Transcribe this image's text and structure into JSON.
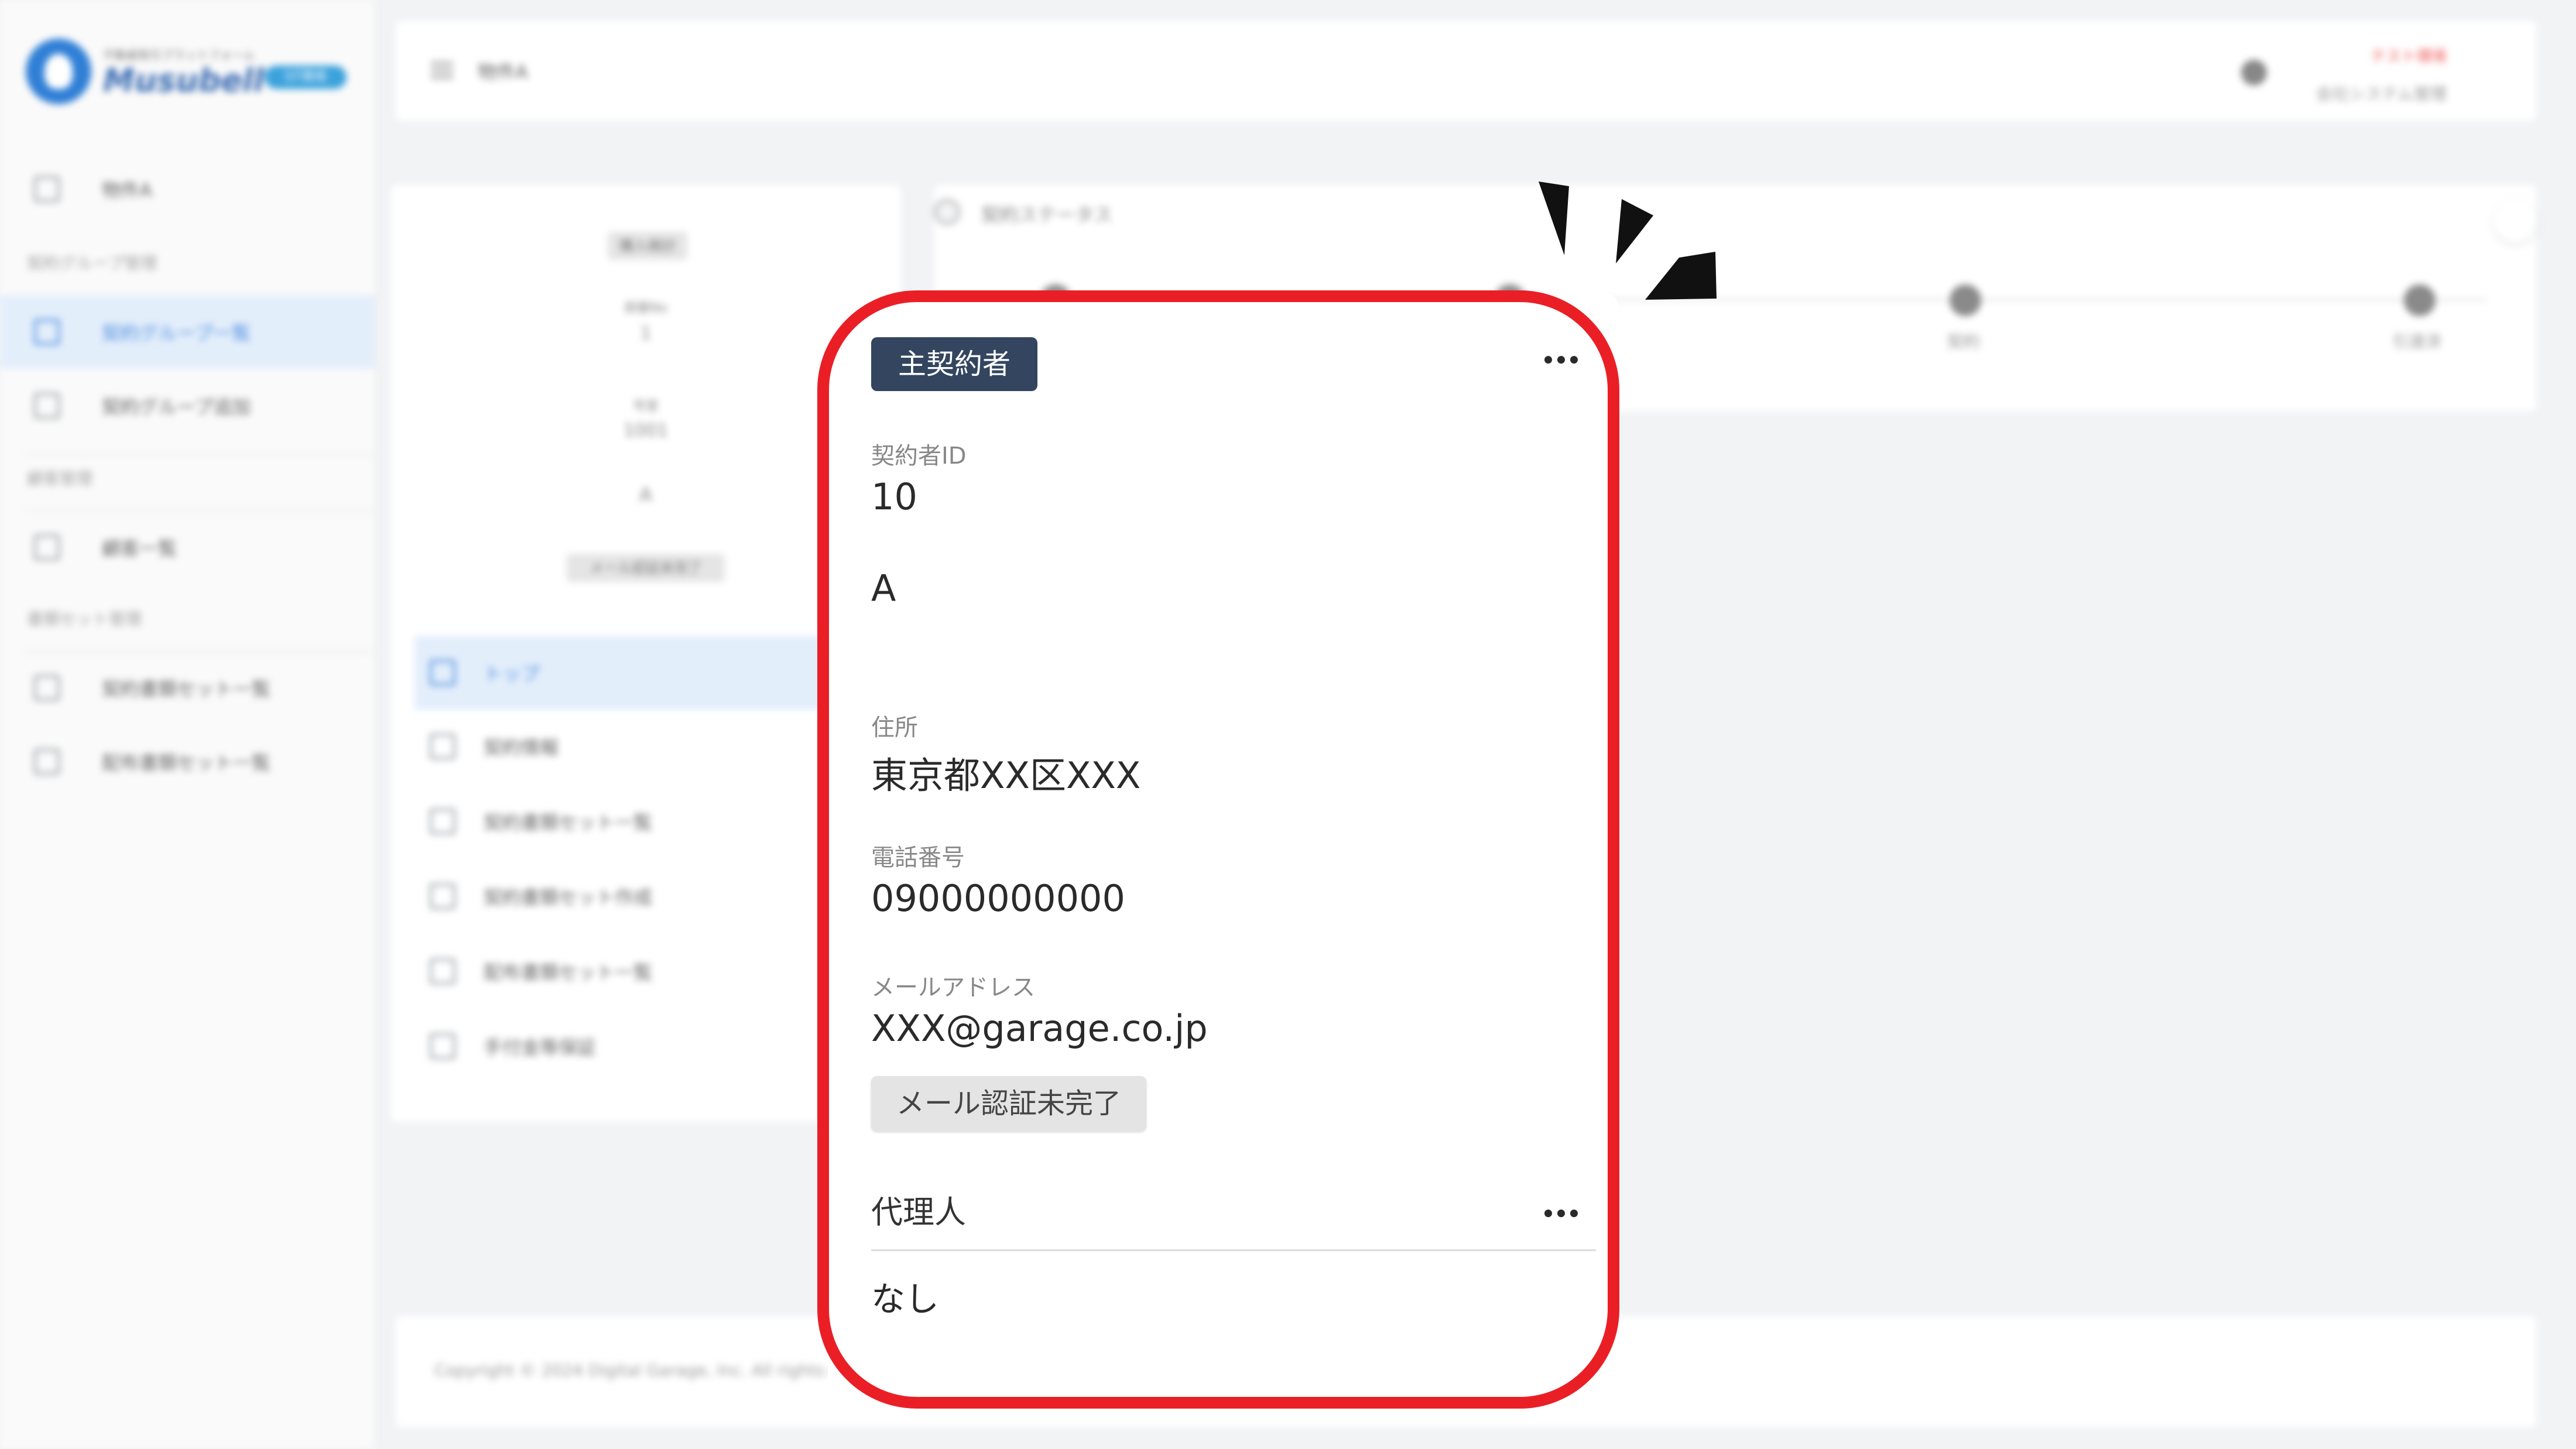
{
  "sidebar": {
    "logo_tagline": "不動産取引プラットフォーム",
    "logo_name": "Musubell",
    "logo_badge": "ST環境",
    "items": [
      {
        "label": "物件A",
        "active": false
      },
      {
        "heading": "契約グループ管理"
      },
      {
        "label": "契約グループ一覧",
        "active": true
      },
      {
        "label": "契約グループ追加",
        "active": false
      },
      {
        "heading": "顧客管理"
      },
      {
        "label": "顧客一覧",
        "active": false
      },
      {
        "heading": "書類セット管理"
      },
      {
        "label": "契約書類セット一覧",
        "active": false
      },
      {
        "label": "配布書類セット一覧",
        "active": false
      }
    ]
  },
  "header": {
    "title": "物件A",
    "warning": "テスト環境",
    "user_role": "会社システム管理"
  },
  "left_card": {
    "tag": "購入検討",
    "field1_label": "部屋No",
    "field1_value": "1",
    "field2_label": "号室",
    "field2_value": "1001",
    "name": "A",
    "mail_status": "メール認証未完了",
    "menu": [
      {
        "label": "トップ",
        "active": true
      },
      {
        "label": "契約情報",
        "active": false
      },
      {
        "label": "契約書類セット一覧",
        "active": false
      },
      {
        "label": "契約書類セット作成",
        "active": false
      },
      {
        "label": "配布書類セット一覧",
        "active": false
      },
      {
        "label": "手付金等保証",
        "active": false
      }
    ]
  },
  "status": {
    "title": "契約ステータス",
    "steps": [
      "",
      "",
      "契約",
      "引渡済"
    ]
  },
  "footer": {
    "copyright": "Copyright © 2024 Digital Garage, Inc. All rights reserved."
  },
  "contractor": {
    "badge": "主契約者",
    "id_label": "契約者ID",
    "id_value": "10",
    "name_value": "A",
    "address_label": "住所",
    "address_value": "東京都XX区XXX",
    "phone_label": "電話番号",
    "phone_value": "09000000000",
    "email_label": "メールアドレス",
    "email_value": "XXX@garage.co.jp",
    "email_status": "メール認証未完了",
    "agent_label": "代理人",
    "agent_value": "なし"
  },
  "colors": {
    "highlight_ring": "#ea1f26",
    "badge_bg": "#33455f",
    "accent": "#4e8ede"
  }
}
